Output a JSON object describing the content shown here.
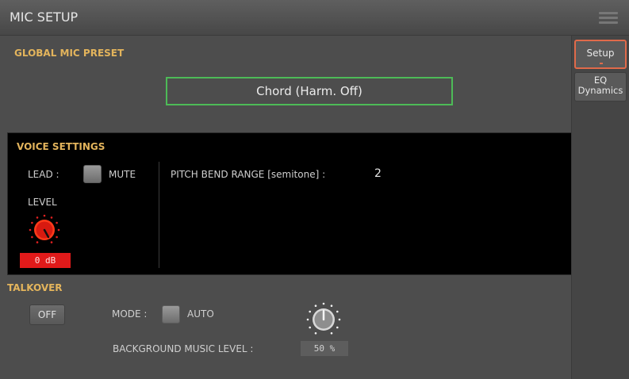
{
  "window": {
    "title": "MIC SETUP"
  },
  "sidebar": {
    "tabs": [
      {
        "label": "Setup",
        "active": true
      },
      {
        "label_line1": "EQ",
        "label_line2": "Dynamics",
        "active": false
      }
    ]
  },
  "global_preset": {
    "label": "GLOBAL MIC PRESET",
    "value": "Chord (Harm. Off)"
  },
  "voice_settings": {
    "label": "VOICE SETTINGS",
    "lead_label": "LEAD :",
    "mute_label": "MUTE",
    "pitch_bend_label": "PITCH BEND RANGE [semitone] :",
    "pitch_bend_value": "2",
    "level_label": "LEVEL",
    "level_value": "0 dB"
  },
  "talkover": {
    "label": "TALKOVER",
    "button_label": "OFF",
    "mode_label": "MODE :",
    "auto_label": "AUTO",
    "bg_music_label": "BACKGROUND MUSIC LEVEL :",
    "bg_music_value": "50 %"
  },
  "colors": {
    "accent_orange": "#e06a4a",
    "section_label": "#e3b45c",
    "preset_border": "#4dbb57",
    "level_red": "#e11a1a"
  }
}
